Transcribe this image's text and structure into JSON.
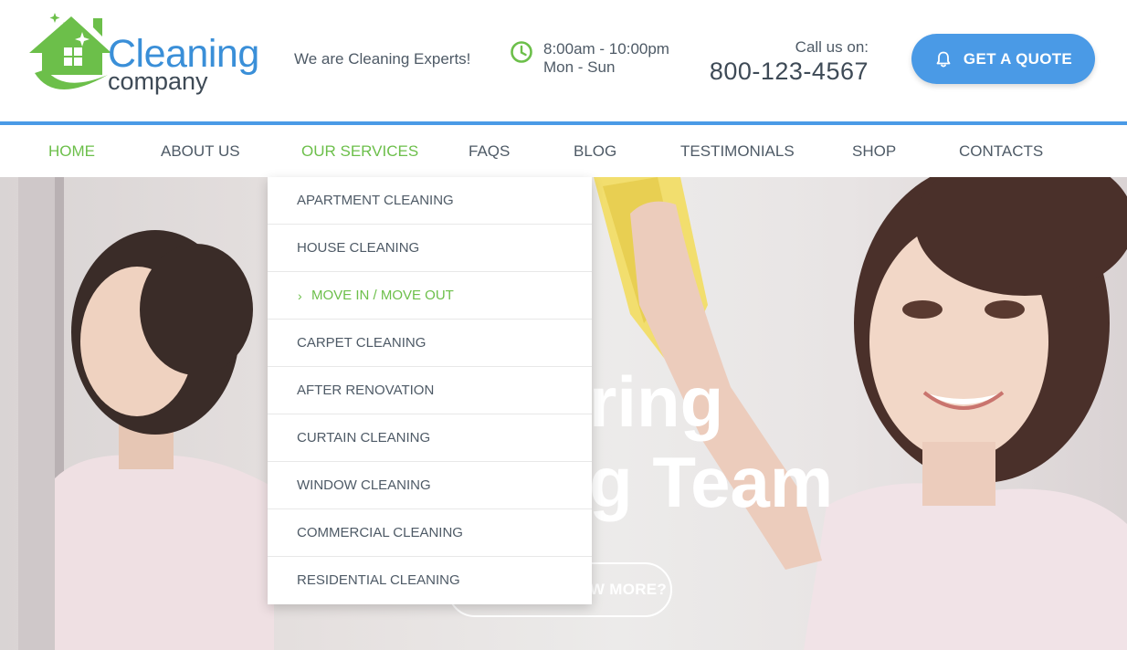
{
  "brand": {
    "name": "Cleaning",
    "sub": "company",
    "primary_color": "#4a9ae6",
    "accent_color": "#6cbf4a"
  },
  "header": {
    "tagline": "We are Cleaning Experts!",
    "hours": {
      "icon": "clock-icon",
      "time": "8:00am - 10:00pm",
      "days": "Mon - Sun"
    },
    "call": {
      "label": "Call us on:",
      "phone": "800-123-4567"
    },
    "quote_button": {
      "icon": "bell-icon",
      "label": "GET A QUOTE"
    }
  },
  "nav": {
    "items": [
      {
        "label": "HOME",
        "active": true
      },
      {
        "label": "ABOUT US",
        "active": false
      },
      {
        "label": "OUR SERVICES",
        "active": true
      },
      {
        "label": "FAQS",
        "active": false
      },
      {
        "label": "BLOG",
        "active": false
      },
      {
        "label": "TESTIMONIALS",
        "active": false
      },
      {
        "label": "SHOP",
        "active": false
      },
      {
        "label": "CONTACTS",
        "active": false
      }
    ]
  },
  "services_menu": {
    "items": [
      {
        "label": "APARTMENT CLEANING"
      },
      {
        "label": "HOUSE CLEANING"
      },
      {
        "label": "MOVE IN / MOVE OUT",
        "active": true,
        "icon": "chevron-right-icon"
      },
      {
        "label": "CARPET CLEANING"
      },
      {
        "label": "AFTER RENOVATION"
      },
      {
        "label": "CURTAIN CLEANING"
      },
      {
        "label": "WINDOW CLEANING"
      },
      {
        "label": "COMMERCIAL CLEANING"
      },
      {
        "label": "RESIDENTIAL CLEANING"
      }
    ]
  },
  "hero": {
    "line1_visible": "ring",
    "line2_visible": "g Team",
    "button_visible": "W MORE?"
  }
}
